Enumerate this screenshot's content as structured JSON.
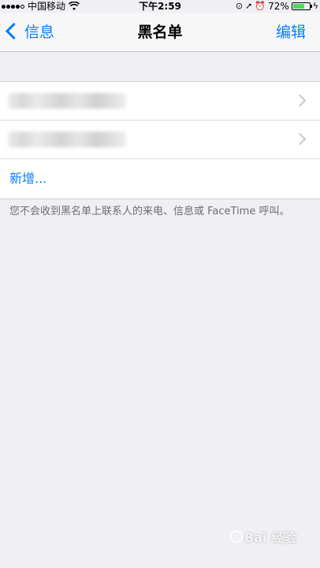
{
  "status_bar": {
    "carrier": "中国移动",
    "time": "下午2:59",
    "battery_percent": "72%",
    "battery_level": 0.72,
    "colors": {
      "battery_fill": "#4cd964"
    }
  },
  "nav": {
    "back_label": "信息",
    "title": "黑名单",
    "edit_label": "编辑"
  },
  "list": {
    "entries": [
      {
        "label": ""
      },
      {
        "label": ""
      }
    ],
    "add_label": "新增..."
  },
  "footer_note": "您不会收到黑名单上联系人的来电、信息或 FaceTime 呼叫。",
  "watermark": {
    "text": "Bai 经验"
  },
  "theme": {
    "accent": "#0a7cff",
    "background": "#efeff4",
    "separator": "#c8c7cc"
  }
}
